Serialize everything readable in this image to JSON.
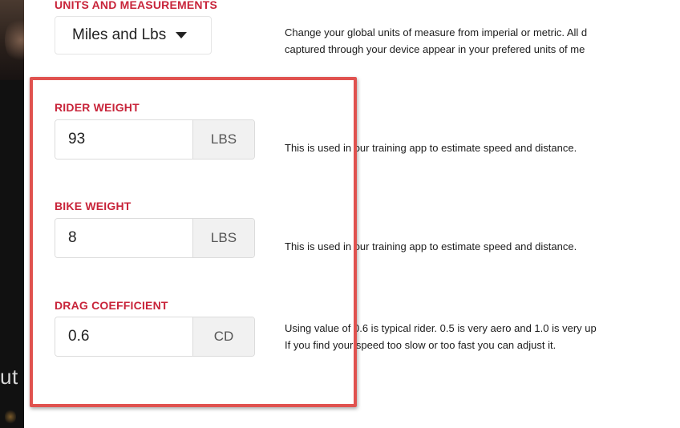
{
  "units": {
    "label": "UNITS AND MEASUREMENTS",
    "selected": "Miles and Lbs",
    "description_line1": "Change your global units of measure from imperial or metric. All d",
    "description_line2": "captured through your device appear in your prefered units of me"
  },
  "rider_weight": {
    "label": "RIDER WEIGHT",
    "value": "93",
    "unit": "LBS",
    "description": "This is used in our training app to estimate speed and distance."
  },
  "bike_weight": {
    "label": "BIKE WEIGHT",
    "value": "8",
    "unit": "LBS",
    "description": "This is used in our training app to estimate speed and distance."
  },
  "drag_coefficient": {
    "label": "DRAG COEFFICIENT",
    "value": "0.6",
    "unit": "CD",
    "description_line1": "Using value of 0.6 is typical rider. 0.5 is very aero and 1.0 is very up",
    "description_line2": "If you find your speed too slow or too fast you can adjust it."
  },
  "left_panel": {
    "fragment_text": "ut"
  },
  "colors": {
    "label_red": "#c8243a",
    "highlight_border": "#e0524f",
    "unit_bg": "#f1f1f1"
  },
  "icons": {
    "select_caret": "caret-down-icon"
  }
}
